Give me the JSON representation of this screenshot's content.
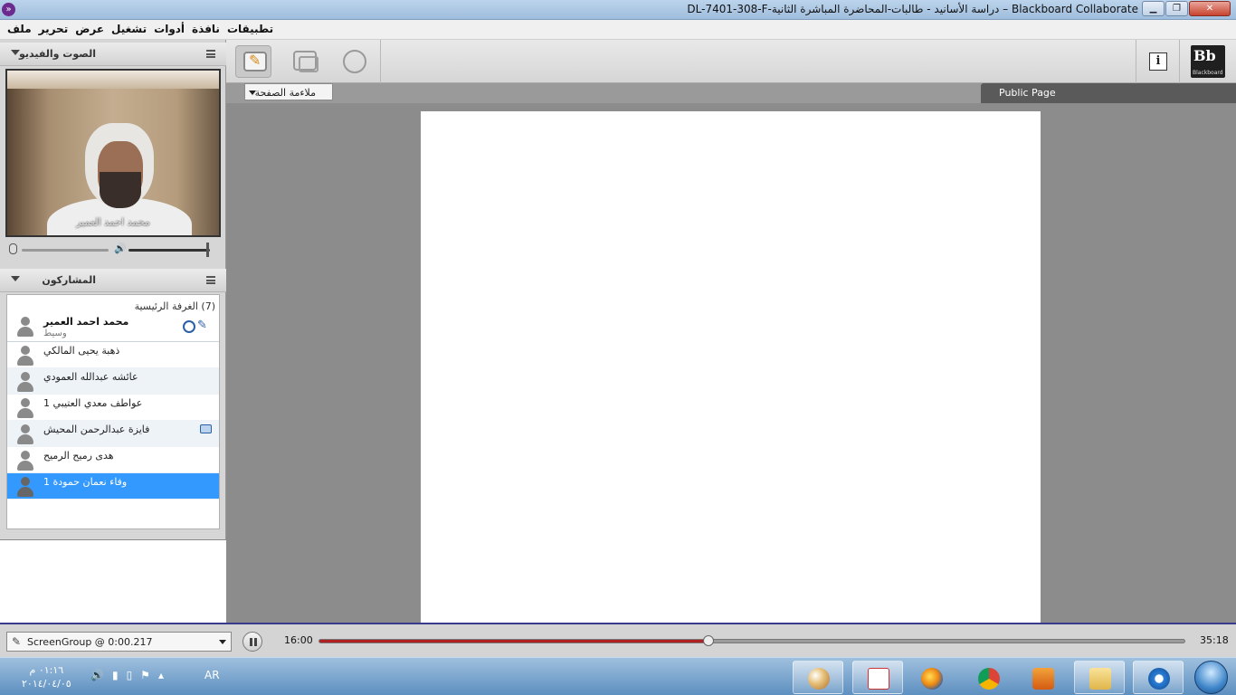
{
  "window": {
    "title": "Blackboard Collaborate – دراسة الأسانيد - طالبات-المحاضرة المباشرة الثانية-DL-7401-308-F"
  },
  "menu": {
    "items": [
      "ملف",
      "تحرير",
      "عرض",
      "تشغيل",
      "أدوات",
      "نافذة",
      "تطبيقات"
    ]
  },
  "audio_video": {
    "title": "الصوت والفيديو",
    "video_label": "محمد احمد العمير"
  },
  "participants": {
    "title": "المشاركون",
    "room_label": "(7) الغرفة الرئيسية",
    "moderator": {
      "name": "محمد احمد العمير",
      "role": "وسيط"
    },
    "list": [
      {
        "name": "ذهبة يحيى المالكي"
      },
      {
        "name": "عائشه عبدالله العمودي"
      },
      {
        "name": "عواطف معدي العتيبي 1"
      },
      {
        "name": "فايزة عبدالرحمن المحيش"
      },
      {
        "name": "هدى رميح الرميح"
      },
      {
        "name": "وفاء نعمان حمودة 1"
      }
    ]
  },
  "whiteboard": {
    "fit_label": "ملاءمة الصفحة",
    "page_tab": "Public Page"
  },
  "branding": {
    "logo_text": "Bb",
    "logo_sub": "Blackboard"
  },
  "playback": {
    "group_label": "ScreenGroup @ 0:00.217",
    "current_time": "16:00",
    "total_time": "35:18",
    "progress": 0.45
  },
  "taskbar": {
    "time": "٠١:١٦ م",
    "date": "٢٠١٤/٠٤/٠٥",
    "lang": "AR"
  },
  "colors": {
    "accent": "#3399ff",
    "progress": "#b12020"
  }
}
